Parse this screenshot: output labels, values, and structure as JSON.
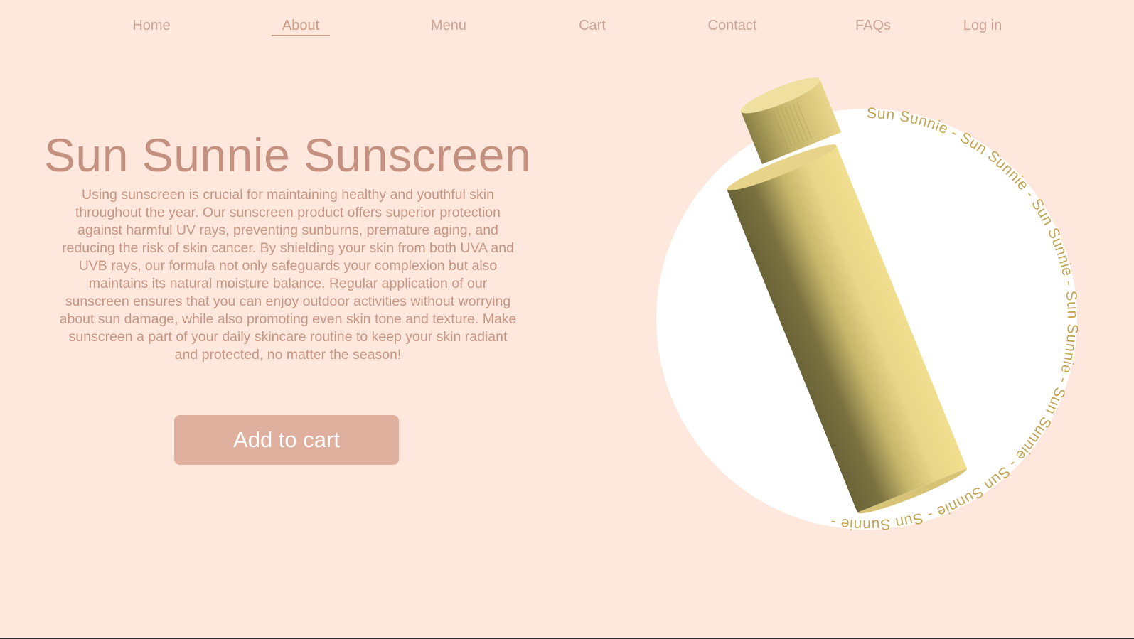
{
  "nav": {
    "items": [
      {
        "label": "Home"
      },
      {
        "label": "About",
        "active": true
      },
      {
        "label": "Menu"
      },
      {
        "label": "Cart"
      },
      {
        "label": "Contact"
      },
      {
        "label": "FAQs"
      },
      {
        "label": "Log in"
      }
    ]
  },
  "hero": {
    "title": "Sun Sunnie Sunscreen",
    "description": "Using sunscreen is crucial for maintaining healthy and youthful skin throughout the year. Our sunscreen product offers superior protection against harmful UV rays, preventing sunburns, premature aging, and reducing the risk of skin cancer. By shielding your skin from both UVA and UVB rays, our formula not only safeguards your complexion but also maintains its natural moisture balance. Regular application of our sunscreen ensures that you can enjoy outdoor activities without worrying about sun damage, while also promoting even skin tone and texture. Make sunscreen a part of your daily skincare routine to keep your skin radiant and protected, no matter the season!",
    "cta_label": "Add to cart"
  },
  "badge": {
    "ring_text": "Sun Sunnie - Sun Sunnie - Sun Sunnie - Sun Sunnie - Sun Sunnie - Sun Sunnie - Sun Sunnie - "
  },
  "colors": {
    "background": "#fee7dc",
    "accent": "#c49180",
    "button": "#dfb09d",
    "bottle": "#ecd98a",
    "ring_text": "#c2a554"
  }
}
